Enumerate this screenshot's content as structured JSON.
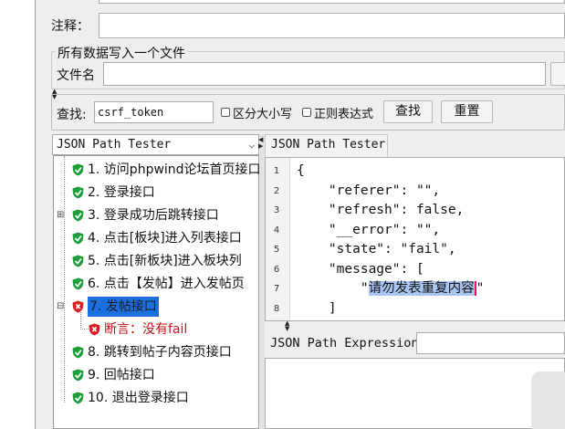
{
  "form": {
    "comment_label": "注释：",
    "group_title": "所有数据写入一个文件",
    "filename_label": "文件名"
  },
  "search": {
    "label": "查找:",
    "value": "csrf_token",
    "case_sensitive_label": "区分大小写",
    "regex_label": "正则表达式",
    "find_button": "查找",
    "reset_button": "重置"
  },
  "left_panel": {
    "dropdown_value": "JSON Path Tester",
    "tree": [
      {
        "label": "1. 访问phpwind论坛首页接口",
        "status": "pass",
        "expandable": false
      },
      {
        "label": "2. 登录接口",
        "status": "pass",
        "expandable": false
      },
      {
        "label": "3. 登录成功后跳转接口",
        "status": "pass",
        "expandable": true
      },
      {
        "label": "4. 点击[板块]进入列表接口",
        "status": "pass",
        "expandable": false
      },
      {
        "label": "5. 点击[新板块]进入板块列",
        "status": "pass",
        "expandable": false
      },
      {
        "label": "6. 点击【发帖】进入发帖页",
        "status": "pass",
        "expandable": false
      },
      {
        "label": "7. 发帖接口",
        "status": "fail",
        "expandable": true,
        "selected": true
      },
      {
        "label": "断言：没有fail",
        "status": "fail",
        "child": true
      },
      {
        "label": "8. 跳转到帖子内容页接口",
        "status": "pass",
        "expandable": false
      },
      {
        "label": "9. 回帖接口",
        "status": "pass",
        "expandable": false
      },
      {
        "label": "10. 退出登录接口",
        "status": "pass",
        "expandable": false
      }
    ]
  },
  "right_panel": {
    "tab_label": "JSON Path Tester",
    "code_lines": [
      {
        "n": "1",
        "text": "{"
      },
      {
        "n": "2",
        "text": "    \"referer\": \"\","
      },
      {
        "n": "3",
        "text": "    \"refresh\": false,"
      },
      {
        "n": "4",
        "text": "    \"__error\": \"\","
      },
      {
        "n": "5",
        "text": "    \"state\": \"fail\","
      },
      {
        "n": "6",
        "text": "    \"message\": ["
      },
      {
        "n": "7",
        "prefix": "        \"",
        "selected": "请勿发表重复内容",
        "suffix": "\""
      },
      {
        "n": "8",
        "text": "    ]"
      }
    ],
    "expression_label": "JSON Path Expression"
  },
  "colors": {
    "pass": "#1e9e3a",
    "fail": "#d81f26",
    "selection": "#1c6fe0",
    "assertion_text": "#c8141b"
  }
}
